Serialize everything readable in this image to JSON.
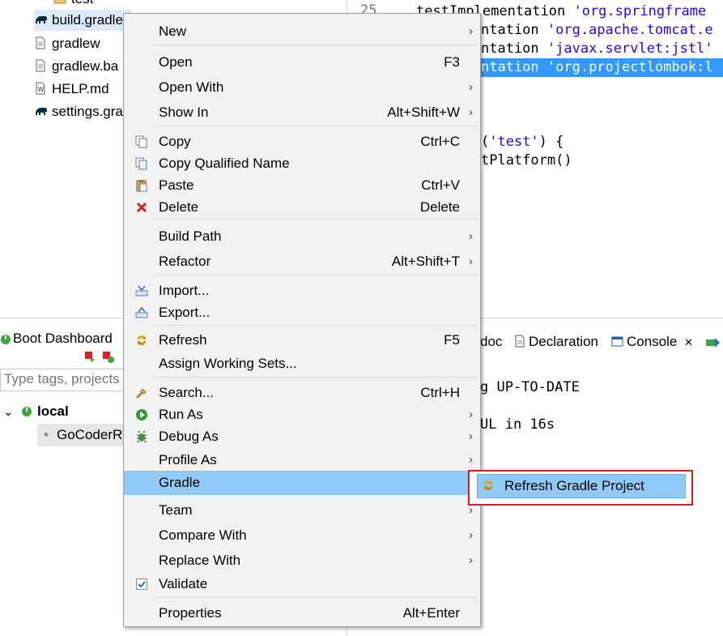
{
  "explorer": {
    "items": [
      {
        "label": "test",
        "icon": "folder-icon"
      },
      {
        "label": "build.gradle",
        "icon": "gradle-elephant-icon"
      },
      {
        "label": "gradlew",
        "icon": "file-icon"
      },
      {
        "label": "gradlew.ba",
        "icon": "file-icon"
      },
      {
        "label": "HELP.md",
        "icon": "markdown-file-icon"
      },
      {
        "label": "settings.gra",
        "icon": "gradle-elephant-icon"
      }
    ]
  },
  "editor": {
    "line_number": "25",
    "lines": [
      {
        "pre": "testImplementation ",
        "str": "'org.springframe"
      },
      {
        "pre": "ntation ",
        "str": "'org.apache.tomcat.e"
      },
      {
        "pre": "ntation ",
        "str": "'javax.servlet:jstl'"
      },
      {
        "pre": "ntation ",
        "str": "'org.projectlombok:l"
      },
      {
        "pre": "(",
        "str": "'test'",
        "post": ") {"
      },
      {
        "pre": "tPlatform()",
        "str": "",
        "post": ""
      }
    ]
  },
  "boot": {
    "title": "Boot Dashboard",
    "filter_placeholder": "Type tags, projects",
    "group": "local",
    "app": "GoCoderR"
  },
  "console": {
    "tabs": [
      "doc",
      "Declaration",
      "Console"
    ],
    "close_glyph": "✕",
    "lines": [
      "g UP-TO-DATE",
      "UL in 16s"
    ]
  },
  "menu": {
    "items": [
      {
        "label": "New",
        "shortcut": "",
        "submenu": true
      },
      {
        "label": "Open",
        "shortcut": "F3",
        "submenu": false
      },
      {
        "label": "Open With",
        "shortcut": "",
        "submenu": true
      },
      {
        "label": "Show In",
        "shortcut": "Alt+Shift+W",
        "submenu": true
      },
      {
        "label": "Copy",
        "shortcut": "Ctrl+C",
        "submenu": false,
        "icon": "copy-icon"
      },
      {
        "label": "Copy Qualified Name",
        "shortcut": "",
        "submenu": false,
        "icon": "copy-qualified-name-icon"
      },
      {
        "label": "Paste",
        "shortcut": "Ctrl+V",
        "submenu": false,
        "icon": "paste-icon"
      },
      {
        "label": "Delete",
        "shortcut": "Delete",
        "submenu": false,
        "icon": "delete-icon"
      },
      {
        "label": "Build Path",
        "shortcut": "",
        "submenu": true
      },
      {
        "label": "Refactor",
        "shortcut": "Alt+Shift+T",
        "submenu": true
      },
      {
        "label": "Import...",
        "shortcut": "",
        "submenu": false,
        "icon": "import-icon"
      },
      {
        "label": "Export...",
        "shortcut": "",
        "submenu": false,
        "icon": "export-icon"
      },
      {
        "label": "Refresh",
        "shortcut": "F5",
        "submenu": false,
        "icon": "refresh-icon"
      },
      {
        "label": "Assign Working Sets...",
        "shortcut": "",
        "submenu": false
      },
      {
        "label": "Search...",
        "shortcut": "Ctrl+H",
        "submenu": false,
        "icon": "search-flashlight-icon"
      },
      {
        "label": "Run As",
        "shortcut": "",
        "submenu": true,
        "icon": "run-icon"
      },
      {
        "label": "Debug As",
        "shortcut": "",
        "submenu": true,
        "icon": "debug-bug-icon"
      },
      {
        "label": "Profile As",
        "shortcut": "",
        "submenu": true
      },
      {
        "label": "Gradle",
        "shortcut": "",
        "submenu": true
      },
      {
        "label": "Team",
        "shortcut": "",
        "submenu": true
      },
      {
        "label": "Compare With",
        "shortcut": "",
        "submenu": true
      },
      {
        "label": "Replace With",
        "shortcut": "",
        "submenu": true
      },
      {
        "label": "Validate",
        "shortcut": "",
        "submenu": false,
        "icon": "checkbox-checked-icon"
      },
      {
        "label": "Properties",
        "shortcut": "Alt+Enter",
        "submenu": false
      }
    ],
    "arrow_glyph": "›"
  },
  "submenu": {
    "label": "Refresh Gradle Project",
    "icon": "refresh-icon"
  },
  "colors": {
    "menu_bg": "#f2f2f2",
    "menu_hover": "#91c9f7",
    "highlight_border": "#e01818",
    "code_string": "#2a00ff",
    "selection": "#3399ff"
  }
}
